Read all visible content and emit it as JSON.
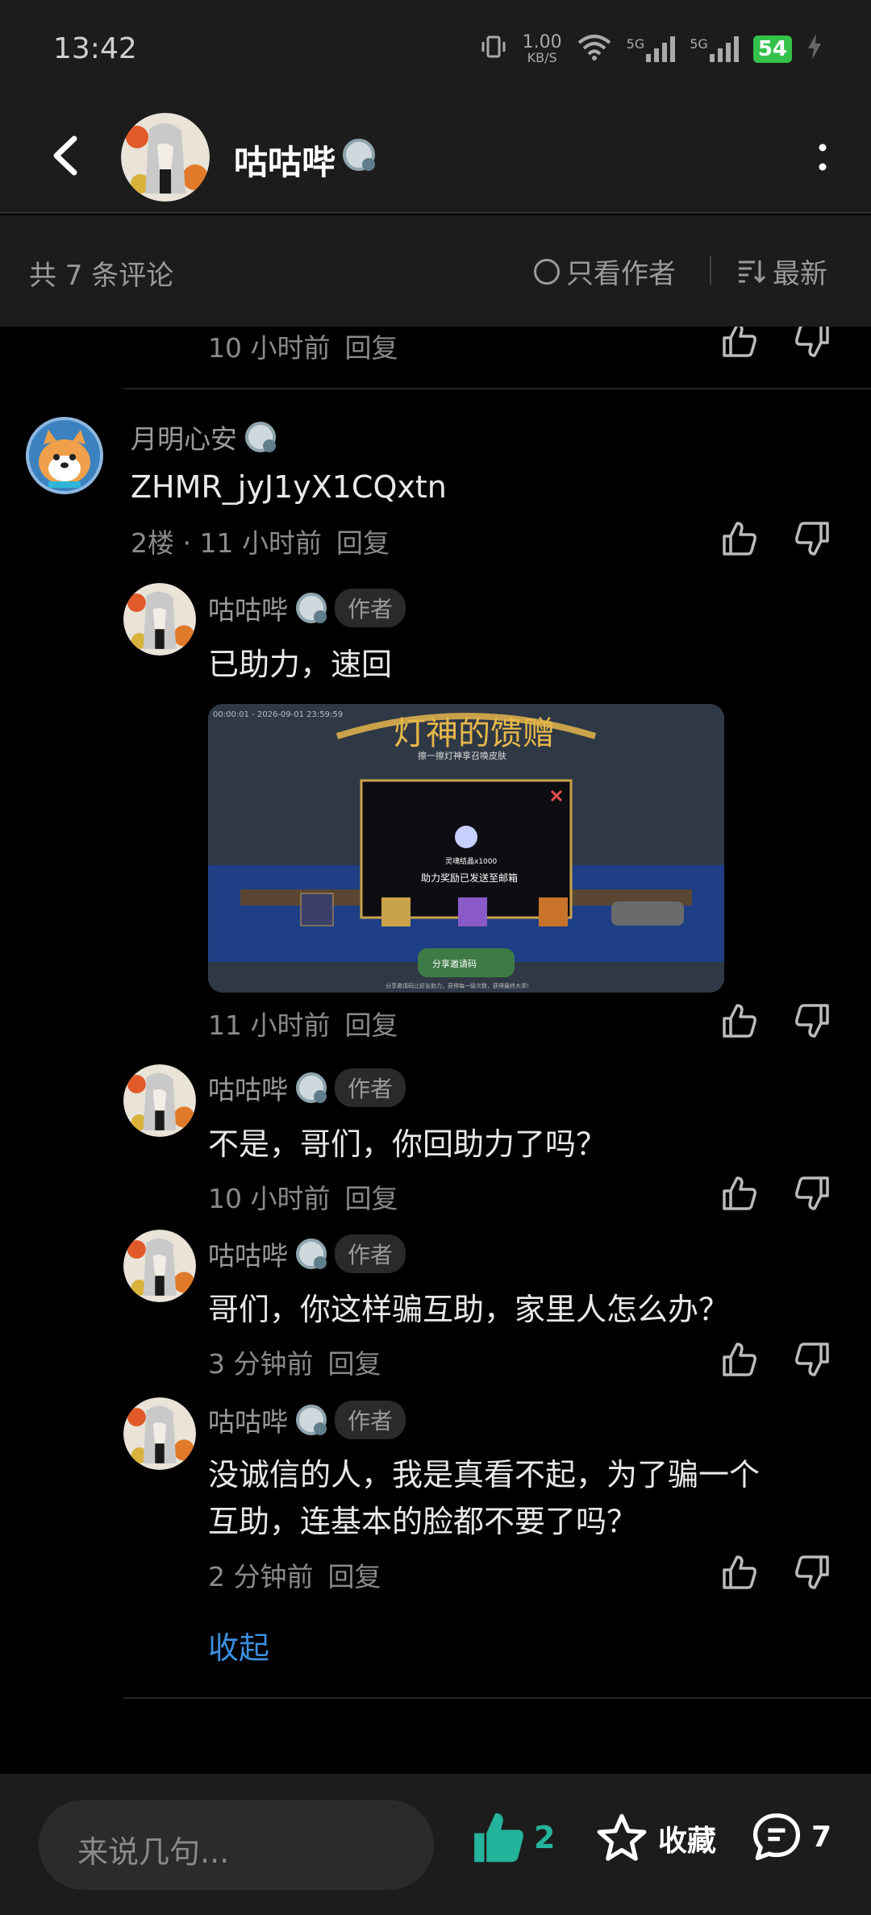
{
  "status_bar": {
    "time": "13:42",
    "net_speed_value": "1.00",
    "net_speed_unit": "KB/S",
    "signal1_label": "5G",
    "signal2_label": "5G",
    "battery": "54"
  },
  "header": {
    "title": "咕咕哔",
    "level_badge": "3"
  },
  "sort_bar": {
    "count_label": "共 7 条评论",
    "only_author_label": "只看作者",
    "sort_label": "最新"
  },
  "comments": {
    "top_partial": {
      "time": "10 小时前",
      "reply": "回复"
    },
    "floor2": {
      "username": "月明心安",
      "level": "1",
      "text": "ZHMR_jyJ1yX1CQxtn",
      "meta": "2楼 · 11 小时前",
      "reply": "回复"
    },
    "replies": [
      {
        "username": "咕咕哔",
        "level": "3",
        "tag": "作者",
        "text": "已助力，速回",
        "time": "11 小时前",
        "reply": "回复"
      },
      {
        "username": "咕咕哔",
        "level": "3",
        "tag": "作者",
        "text": "不是，哥们，你回助力了吗？",
        "time": "10 小时前",
        "reply": "回复"
      },
      {
        "username": "咕咕哔",
        "level": "3",
        "tag": "作者",
        "text": "哥们，你这样骗互助，家里人怎么办？",
        "time": "3 分钟前",
        "reply": "回复"
      },
      {
        "username": "咕咕哔",
        "level": "3",
        "tag": "作者",
        "text_line1": "没诚信的人，我是真看不起，为了骗一个",
        "text_line2": "互助，连基本的脸都不要了吗？",
        "time": "2 分钟前",
        "reply": "回复"
      }
    ],
    "screenshot": {
      "title": "灯神的馈赠",
      "subtitle": "擦一擦灯神享召唤皮肤",
      "date_range": "00:00:01 - 2026-09-01 23:59:59",
      "reward": "灵魂结晶x1000",
      "message": "助力奖励已发送至邮箱",
      "invite_button": "分享邀请码",
      "footer": "分享邀请码让好友助力，获得每一级次数，获得最终大奖!"
    },
    "collapse_label": "收起"
  },
  "bottom_bar": {
    "input_placeholder": "来说几句...",
    "like_count": "2",
    "fav_label": "收藏",
    "comment_count": "7"
  },
  "colors": {
    "accent_green": "#24b39b",
    "link_blue": "#3b8fe0",
    "bar_bg": "#1c1c1c",
    "content_bg": "#000000"
  }
}
